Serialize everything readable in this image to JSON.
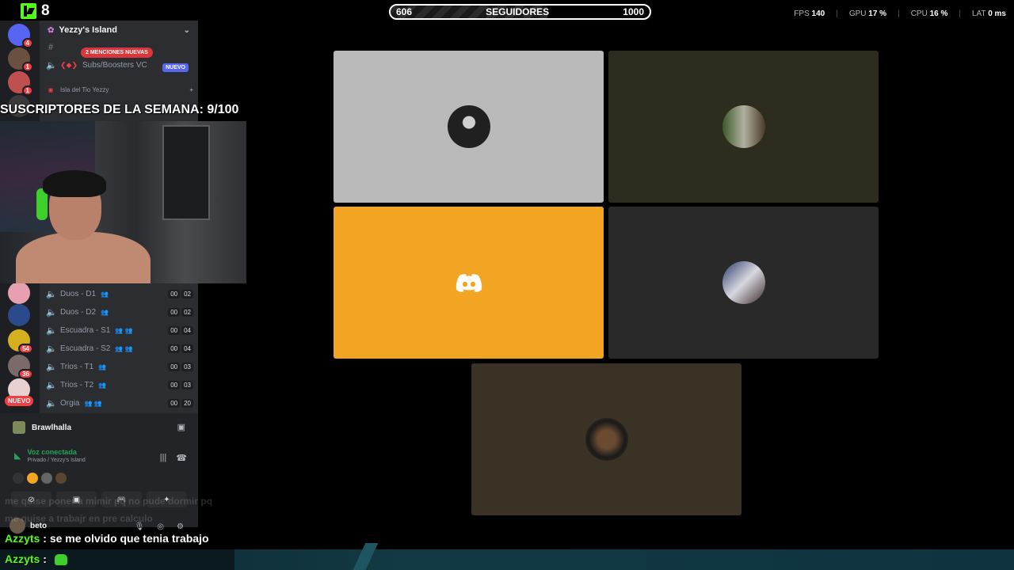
{
  "kick": {
    "logo_icon": "kick-logo-icon",
    "viewer_count": "8",
    "brand_color": "#53fc18"
  },
  "followers": {
    "current": "606",
    "label": "SEGUIDORES",
    "goal": "1000",
    "progress": 0.606
  },
  "perf": {
    "fps_label": "FPS",
    "fps": "140",
    "gpu_label": "GPU",
    "gpu": "17 %",
    "cpu_label": "CPU",
    "cpu": "16 %",
    "lat_label": "LAT",
    "lat": "0 ms"
  },
  "rail": {
    "badges": [
      "4",
      "1",
      "1",
      "54",
      "36"
    ],
    "nuevo": "NUEVO"
  },
  "sidebar": {
    "server_name": "Yezzy's Island",
    "nuevo_badge": "NUEVO",
    "mentions": "2 MENCIONES NUEVAS",
    "top_channels": [
      {
        "name": "Subs/Boosters VC"
      }
    ],
    "category": "Isla del Tio Yezzy",
    "voice_channels": [
      {
        "name": "Duos - D1",
        "a": "00",
        "b": "02"
      },
      {
        "name": "Duos - D2",
        "a": "00",
        "b": "02"
      },
      {
        "name": "Escuadra - S1",
        "a": "00",
        "b": "04"
      },
      {
        "name": "Escuadra - S2",
        "a": "00",
        "b": "04"
      },
      {
        "name": "Trios - T1",
        "a": "00",
        "b": "03"
      },
      {
        "name": "Trios - T2",
        "a": "00",
        "b": "03"
      },
      {
        "name": "Orgia",
        "a": "00",
        "b": "20"
      }
    ]
  },
  "overlay": {
    "subs_goal": "SUSCRIPTORES DE LA SEMANA: 9/100"
  },
  "voice_panel": {
    "game": "Brawlhalla",
    "status": "Voz conectada",
    "channel": "Privado / Yezzy's Island",
    "user": "beto"
  },
  "ghost_text": [
    "me quise poner a mimir pq no pude dormir pq",
    "me quise a trabajr en pre calculo"
  ],
  "chat": [
    {
      "user": "Azzyts",
      "sep": ":",
      "message": "se me olvido que tenia trabajo"
    },
    {
      "user": "Azzyts",
      "sep": ":",
      "message": ""
    }
  ],
  "tiles": {
    "colors": [
      "#b9b9b9",
      "#2e2b1f",
      "#f2a522",
      "#292929",
      "#3a3224"
    ],
    "discord_color": "#f2a522"
  }
}
